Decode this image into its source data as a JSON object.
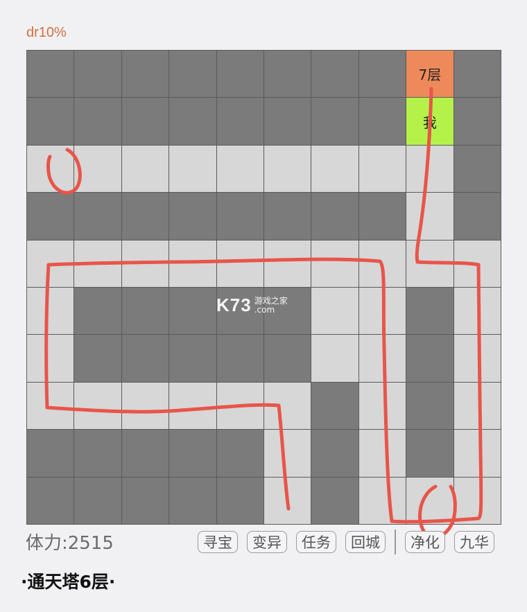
{
  "header": {
    "dr_text": "dr10%"
  },
  "map": {
    "legend": {
      "W": "wall",
      "F": "floor",
      "S": "stairs",
      "P": "player"
    },
    "rows": [
      [
        "W",
        "W",
        "W",
        "W",
        "W",
        "W",
        "W",
        "W",
        "S",
        "W"
      ],
      [
        "W",
        "W",
        "W",
        "W",
        "W",
        "W",
        "W",
        "W",
        "P",
        "W"
      ],
      [
        "F",
        "F",
        "F",
        "F",
        "F",
        "F",
        "F",
        "F",
        "F",
        "W"
      ],
      [
        "W",
        "W",
        "W",
        "W",
        "W",
        "W",
        "W",
        "W",
        "F",
        "W"
      ],
      [
        "F",
        "F",
        "F",
        "F",
        "F",
        "F",
        "F",
        "F",
        "F",
        "F"
      ],
      [
        "F",
        "W",
        "W",
        "W",
        "W",
        "W",
        "F",
        "F",
        "W",
        "F"
      ],
      [
        "F",
        "W",
        "W",
        "W",
        "W",
        "W",
        "F",
        "F",
        "W",
        "F"
      ],
      [
        "F",
        "F",
        "F",
        "F",
        "F",
        "F",
        "W",
        "F",
        "W",
        "F"
      ],
      [
        "W",
        "W",
        "W",
        "W",
        "W",
        "F",
        "W",
        "F",
        "W",
        "F"
      ],
      [
        "W",
        "W",
        "W",
        "W",
        "W",
        "F",
        "W",
        "F",
        "F",
        "F"
      ]
    ],
    "stairs_label": "7层",
    "player_label": "我",
    "colors": {
      "wall": "#7b7b7b",
      "floor": "#d7d7d7",
      "stairs": "#ee8a5a",
      "player": "#b4f24a",
      "annotation": "#e8554a"
    }
  },
  "watermark": {
    "logo": "K73",
    "line1": "游戏之家",
    "line2": ".com"
  },
  "footer": {
    "stamina": "体力:2515",
    "actions": [
      "寻宝",
      "变异",
      "任务",
      "回城",
      "净化",
      "九华"
    ],
    "floor_title": "·通天塔6层·"
  }
}
